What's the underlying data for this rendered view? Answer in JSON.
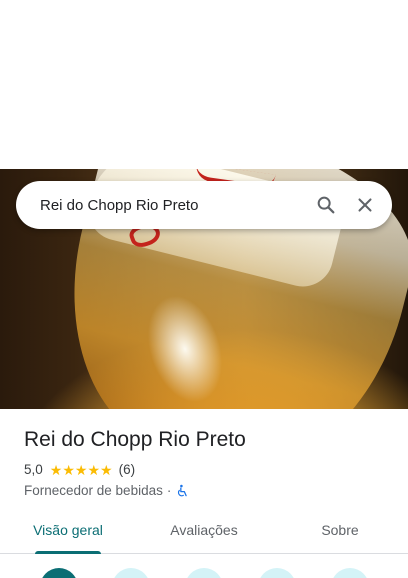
{
  "search": {
    "query": "Rei do Chopp Rio Preto"
  },
  "place": {
    "name": "Rei do Chopp Rio Preto",
    "rating": "5,0",
    "stars": 5,
    "review_count": "(6)",
    "category": "Fornecedor de bebidas",
    "separator": "·"
  },
  "tabs": [
    {
      "label": "Visão geral",
      "active": true
    },
    {
      "label": "Avaliações",
      "active": false
    },
    {
      "label": "Sobre",
      "active": false
    }
  ],
  "icons": {
    "search": "search-icon",
    "close": "close-icon",
    "accessibility": "wheelchair-icon",
    "star": "star-icon"
  },
  "colors": {
    "accent": "#0b6e74",
    "star": "#fbbc04",
    "action_primary": "#0b6e74",
    "action_secondary": "#d4f3f7"
  }
}
